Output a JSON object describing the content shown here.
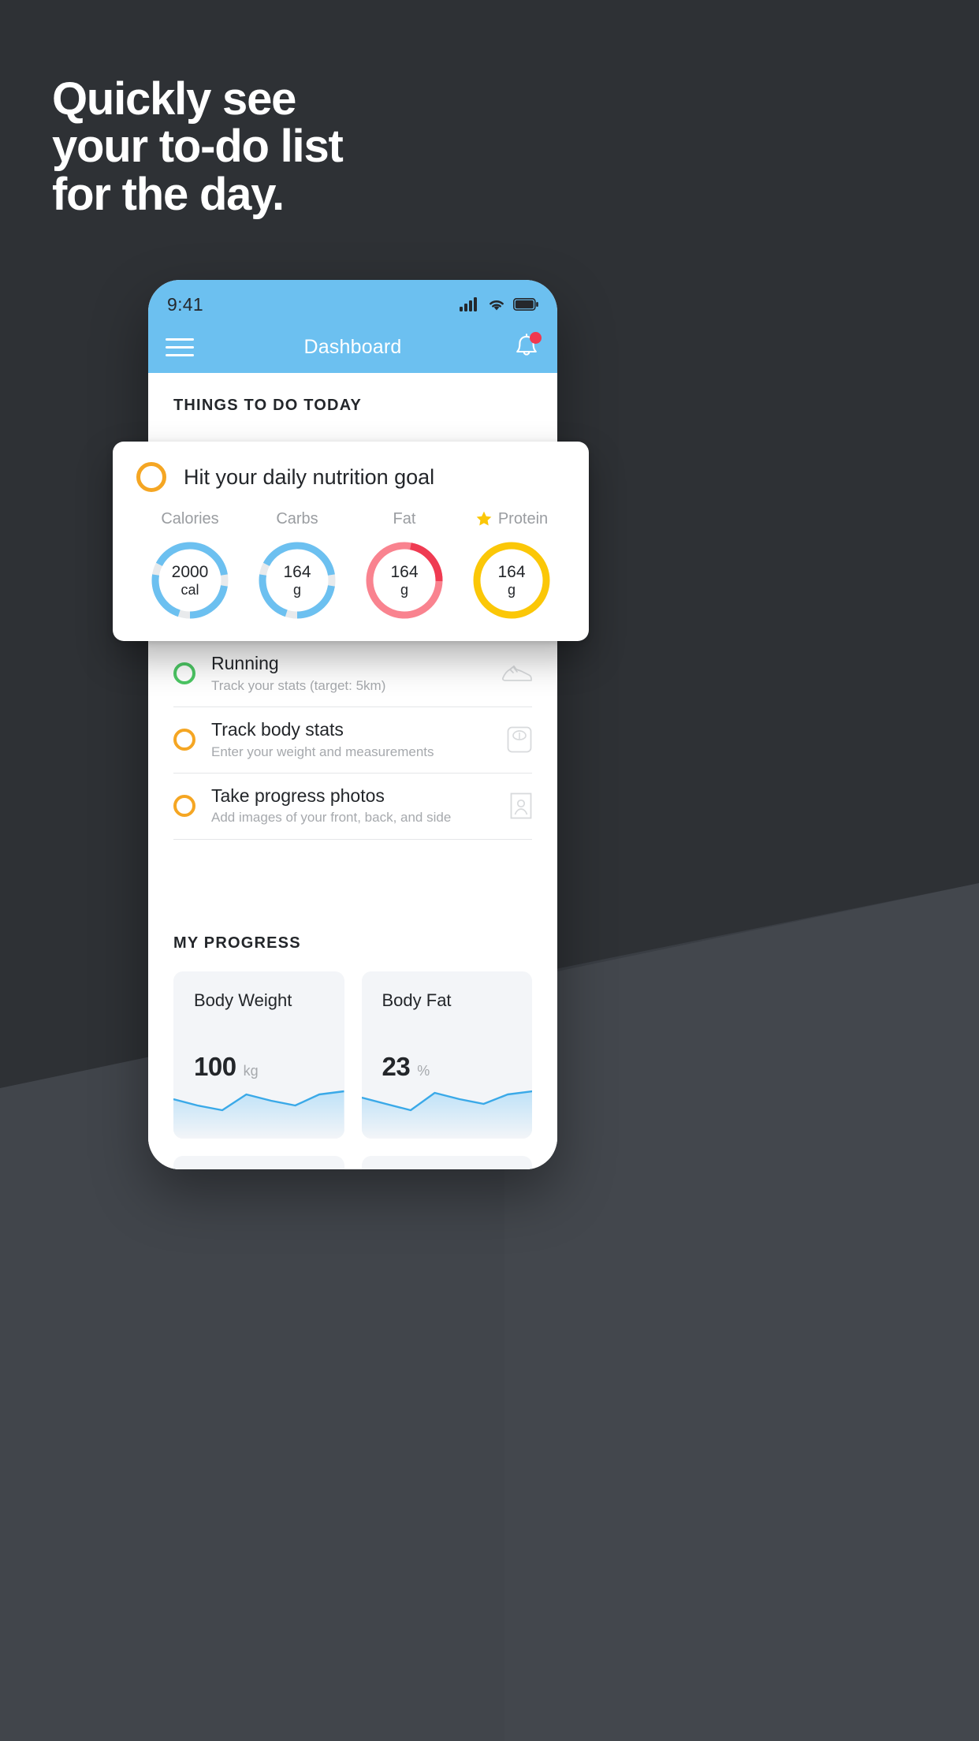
{
  "promo": {
    "headline_lines": [
      "Quickly see",
      "your to-do list",
      "for the day."
    ],
    "background_color": "#2e3135",
    "band_color": "#41454b"
  },
  "phone": {
    "status_bar": {
      "time": "9:41",
      "icons": [
        "cellular-signal-icon",
        "wifi-icon",
        "battery-icon"
      ]
    },
    "navbar": {
      "menu_icon": "hamburger-menu-icon",
      "title": "Dashboard",
      "notification_icon": "bell-icon",
      "has_badge": true,
      "accent_color": "#6cc0f0"
    },
    "sections": {
      "todo_label": "THINGS TO DO TODAY",
      "progress_label": "MY PROGRESS"
    },
    "todos": [
      {
        "title": "Running",
        "subtitle": "Track your stats (target: 5km)",
        "radio_color": "#4cc764",
        "icon": "running-shoe-icon"
      },
      {
        "title": "Track body stats",
        "subtitle": "Enter your weight and measurements",
        "radio_color": "#f5a623",
        "icon": "weight-scale-icon"
      },
      {
        "title": "Take progress photos",
        "subtitle": "Add images of your front, back, and side",
        "radio_color": "#f5a623",
        "icon": "photo-person-icon"
      }
    ],
    "progress_cards": [
      {
        "title": "Body Weight",
        "value": "100",
        "unit": "kg"
      },
      {
        "title": "Body Fat",
        "value": "23",
        "unit": "%"
      }
    ]
  },
  "nutrition_card": {
    "radio_color": "#f5a623",
    "title": "Hit your daily nutrition goal",
    "star_icon": "star-icon",
    "rings": [
      {
        "label": "Calories",
        "value": "2000",
        "unit": "cal",
        "color": "#6cc0f0",
        "track": "#e8eaec",
        "percent": 80,
        "starred": false
      },
      {
        "label": "Carbs",
        "value": "164",
        "unit": "g",
        "color": "#6cc0f0",
        "track": "#e8eaec",
        "percent": 80,
        "starred": false
      },
      {
        "label": "Fat",
        "value": "164",
        "unit": "g",
        "color": "#f9838f",
        "track": "#f9838f",
        "percent": 22,
        "starred": false,
        "highlight": "#ef3b52"
      },
      {
        "label": "Protein",
        "value": "164",
        "unit": "g",
        "color": "#fbc707",
        "track": "#fbc707",
        "percent": 100,
        "starred": true
      }
    ]
  },
  "chart_data": [
    {
      "type": "area",
      "title": "Body Weight",
      "ylabel": "kg",
      "x": [
        0,
        1,
        2,
        3,
        4,
        5,
        6,
        7
      ],
      "values": [
        56,
        46,
        40,
        62,
        68,
        50,
        56,
        70
      ],
      "line_color": "#3aa9e8",
      "fill_color": "#cfe8fa"
    },
    {
      "type": "area",
      "title": "Body Fat",
      "ylabel": "%",
      "x": [
        0,
        1,
        2,
        3,
        4,
        5,
        6,
        7
      ],
      "values": [
        58,
        48,
        40,
        66,
        56,
        48,
        64,
        70
      ],
      "line_color": "#3aa9e8",
      "fill_color": "#cfe8fa"
    }
  ]
}
